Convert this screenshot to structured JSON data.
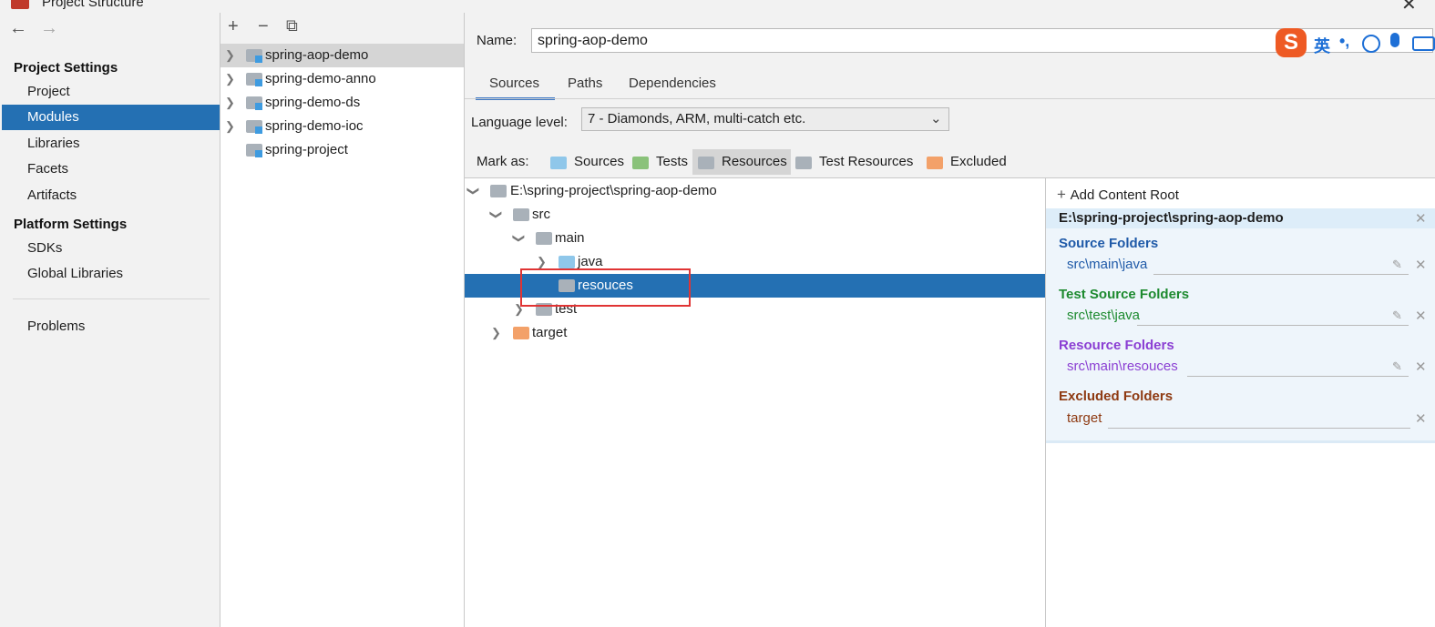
{
  "window": {
    "title": "Project Structure"
  },
  "nav": {
    "back_icon": "←",
    "forward_icon": "→",
    "project_settings_header": "Project Settings",
    "project_settings": [
      "Project",
      "Modules",
      "Libraries",
      "Facets",
      "Artifacts"
    ],
    "platform_settings_header": "Platform Settings",
    "platform_settings": [
      "SDKs",
      "Global Libraries"
    ],
    "problems": "Problems",
    "selected": "Modules"
  },
  "modules": {
    "toolbar": {
      "add": "+",
      "remove": "−",
      "copy": "⧉"
    },
    "items": [
      "spring-aop-demo",
      "spring-demo-anno",
      "spring-demo-ds",
      "spring-demo-ioc",
      "spring-project"
    ],
    "selected": "spring-aop-demo"
  },
  "module": {
    "name_label": "Name:",
    "name_value": "spring-aop-demo",
    "tabs": [
      "Sources",
      "Paths",
      "Dependencies"
    ],
    "active_tab": "Sources",
    "language_label": "Language level:",
    "language_value": "7 - Diamonds, ARM, multi-catch etc.",
    "mark_as_label": "Mark as:",
    "mark_as": [
      "Sources",
      "Tests",
      "Resources",
      "Test Resources",
      "Excluded"
    ],
    "mark_as_selected": "Resources"
  },
  "tree": {
    "root": "E:\\spring-project\\spring-aop-demo",
    "src": "src",
    "main": "main",
    "java": "java",
    "resouces": "resouces",
    "test": "test",
    "target": "target",
    "selected": "resouces"
  },
  "roots": {
    "add_content_root": "Add Content Root",
    "root_path": "E:\\spring-project\\spring-aop-demo",
    "source_folders_label": "Source Folders",
    "source_folders": [
      "src\\main\\java"
    ],
    "test_source_folders_label": "Test Source Folders",
    "test_source_folders": [
      "src\\test\\java"
    ],
    "resource_folders_label": "Resource Folders",
    "resource_folders": [
      "src\\main\\resouces"
    ],
    "excluded_folders_label": "Excluded Folders",
    "excluded_folders": [
      "target"
    ]
  },
  "ime": {
    "logo": "S",
    "lang": "英",
    "punct": "•,"
  },
  "colors": {
    "selection": "#2470b3",
    "source_folders": "#1f5aa8",
    "test_source_folders": "#1d8a2f",
    "resource_folders": "#8b3fd3",
    "excluded_folders": "#8e3a12",
    "highlight_box": "#e03434"
  }
}
